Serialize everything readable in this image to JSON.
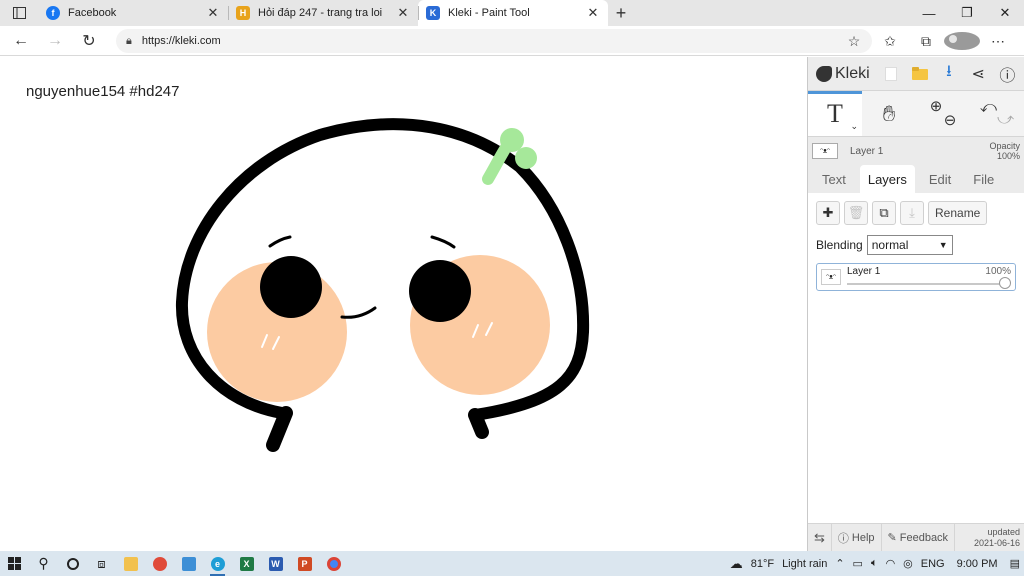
{
  "browser": {
    "tabs": [
      {
        "title": "Facebook",
        "icon": "facebook-icon",
        "color": "#1877f2",
        "glyph": "f"
      },
      {
        "title": "Hỏi đáp 247 - trang tra loi",
        "icon": "hoidap-icon",
        "color": "#e8a31b",
        "glyph": "H"
      },
      {
        "title": "Kleki - Paint Tool",
        "icon": "kleki-icon",
        "color": "#2a6bd6",
        "glyph": "K"
      }
    ],
    "new_tab_glyph": "+",
    "url": "https://kleki.com"
  },
  "canvas": {
    "annotation": "nguyenhue154 #hd247"
  },
  "kleki": {
    "logo": "Kleki",
    "layer_preview": {
      "name": "Layer 1",
      "opacity_label": "Opacity",
      "opacity_value": "100%"
    },
    "tabs": [
      "Text",
      "Layers",
      "Edit",
      "File"
    ],
    "active_tab": "Layers",
    "rename_label": "Rename",
    "blending_label": "Blending",
    "blending_value": "normal",
    "layer_item": {
      "name": "Layer 1",
      "opacity": "100%"
    },
    "footer": {
      "help": "Help",
      "feedback": "Feedback",
      "updated_label": "updated",
      "updated_date": "2021-06-16"
    }
  },
  "taskbar": {
    "weather_temp": "81°F",
    "weather_desc": "Light rain",
    "lang": "ENG",
    "time": "9:00 PM"
  },
  "colors": {
    "cheek": "#fccba2",
    "sprout": "#a6e89a",
    "accent": "#4e95d8"
  }
}
